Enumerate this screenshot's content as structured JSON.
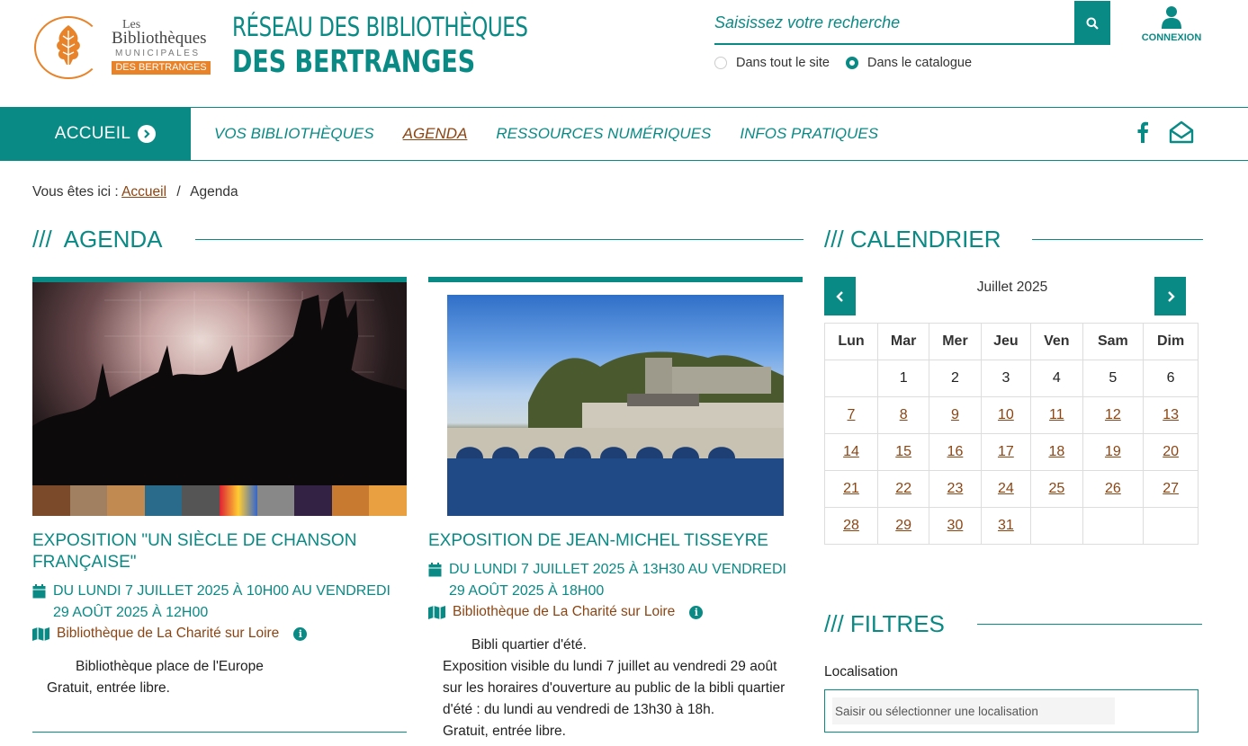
{
  "header": {
    "logo": {
      "les": "Les",
      "bibliotheques": "Bibliothèques",
      "municipales": "MUNICIPALES",
      "des_bertranges": "DES BERTRANGES"
    },
    "title_line1": "RÉSEAU DES BIBLIOTHÈQUES",
    "title_line2": "DES BERTRANGES",
    "search": {
      "placeholder": "Saisissez votre recherche"
    },
    "scope_options": [
      {
        "label": "Dans tout le site",
        "selected": false
      },
      {
        "label": "Dans le catalogue",
        "selected": true
      }
    ],
    "login_label": "CONNEXION"
  },
  "nav": {
    "home": "ACCUEIL",
    "items": [
      "VOS BIBLIOTHÈQUES",
      "AGENDA",
      "RESSOURCES NUMÉRIQUES",
      "INFOS PRATIQUES"
    ],
    "active": "AGENDA",
    "social_icons": [
      "facebook-icon",
      "newsletter-icon"
    ]
  },
  "breadcrumb": {
    "prefix": "Vous êtes ici :",
    "home": "Accueil",
    "current": "Agenda"
  },
  "agenda": {
    "title": "///  AGENDA",
    "events": [
      {
        "title": "EXPOSITION \"UN SIÈCLE DE CHANSON FRANÇAISE\"",
        "date": "DU LUNDI 7 JUILLET 2025 À 10H00 AU VENDREDI 29 AOÛT 2025 À 12H00",
        "location": "Bibliothèque de La Charité sur Loire",
        "desc1": "Bibliothèque place de l'Europe",
        "desc2": "Gratuit, entrée libre."
      },
      {
        "title": "EXPOSITION DE JEAN-MICHEL TISSEYRE",
        "date": "DU LUNDI 7 JUILLET 2025 À 13H30 AU VENDREDI 29 AOÛT 2025 À 18H00",
        "location": "Bibliothèque de La Charité sur Loire",
        "desc1": "Bibli quartier d'été.",
        "desc2": "Exposition visible du lundi 7 juillet au vendredi 29 août sur les horaires d'ouverture au public de la bibli quartier d'été : du lundi au vendredi de 13h30 à 18h.",
        "desc3": "Gratuit, entrée libre."
      }
    ]
  },
  "calendar": {
    "title": "/// CALENDRIER",
    "month": "Juillet 2025",
    "weekdays": [
      "Lun",
      "Mar",
      "Mer",
      "Jeu",
      "Ven",
      "Sam",
      "Dim"
    ],
    "weeks": [
      [
        "",
        "1",
        "2",
        "3",
        "4",
        "5",
        "6"
      ],
      [
        "7",
        "8",
        "9",
        "10",
        "11",
        "12",
        "13"
      ],
      [
        "14",
        "15",
        "16",
        "17",
        "18",
        "19",
        "20"
      ],
      [
        "21",
        "22",
        "23",
        "24",
        "25",
        "26",
        "27"
      ],
      [
        "28",
        "29",
        "30",
        "31",
        "",
        "",
        ""
      ]
    ],
    "linked_from": 7
  },
  "filters": {
    "title": "/// FILTRES",
    "location_label": "Localisation",
    "location_placeholder": "Saisir ou sélectionner une localisation"
  },
  "colors": {
    "teal": "#0a8a85",
    "brown": "#8b4513",
    "orange": "#e8832a"
  }
}
